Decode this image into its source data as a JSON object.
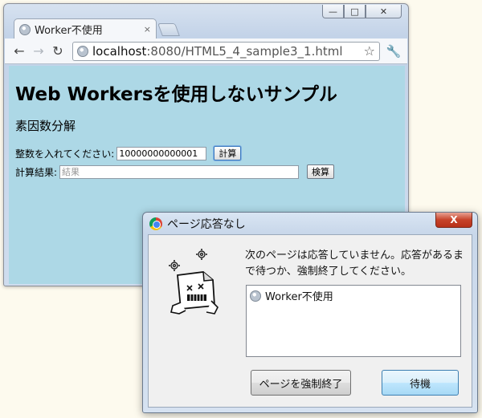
{
  "browser": {
    "tab_title": "Worker不使用",
    "tab_close": "×",
    "url_host": "localhost",
    "url_rest": ":8080/HTML5_4_sample3_1.html",
    "window_min": "—",
    "window_max": "□",
    "window_close": "✕"
  },
  "page": {
    "heading": "Web Workersを使用しないサンプル",
    "subheading": "素因数分解",
    "input_label": "整数を入れてください:",
    "input_value": "10000000000001",
    "calc_button": "計算",
    "result_label": "計算結果:",
    "result_placeholder": "結果",
    "verify_button": "検算"
  },
  "dialog": {
    "title": "ページ応答なし",
    "close": "X",
    "message": "次のページは応答していません。応答があるまで待つか、強制終了してください。",
    "pages": [
      "Worker不使用"
    ],
    "kill_button": "ページを強制終了",
    "wait_button": "待機"
  }
}
